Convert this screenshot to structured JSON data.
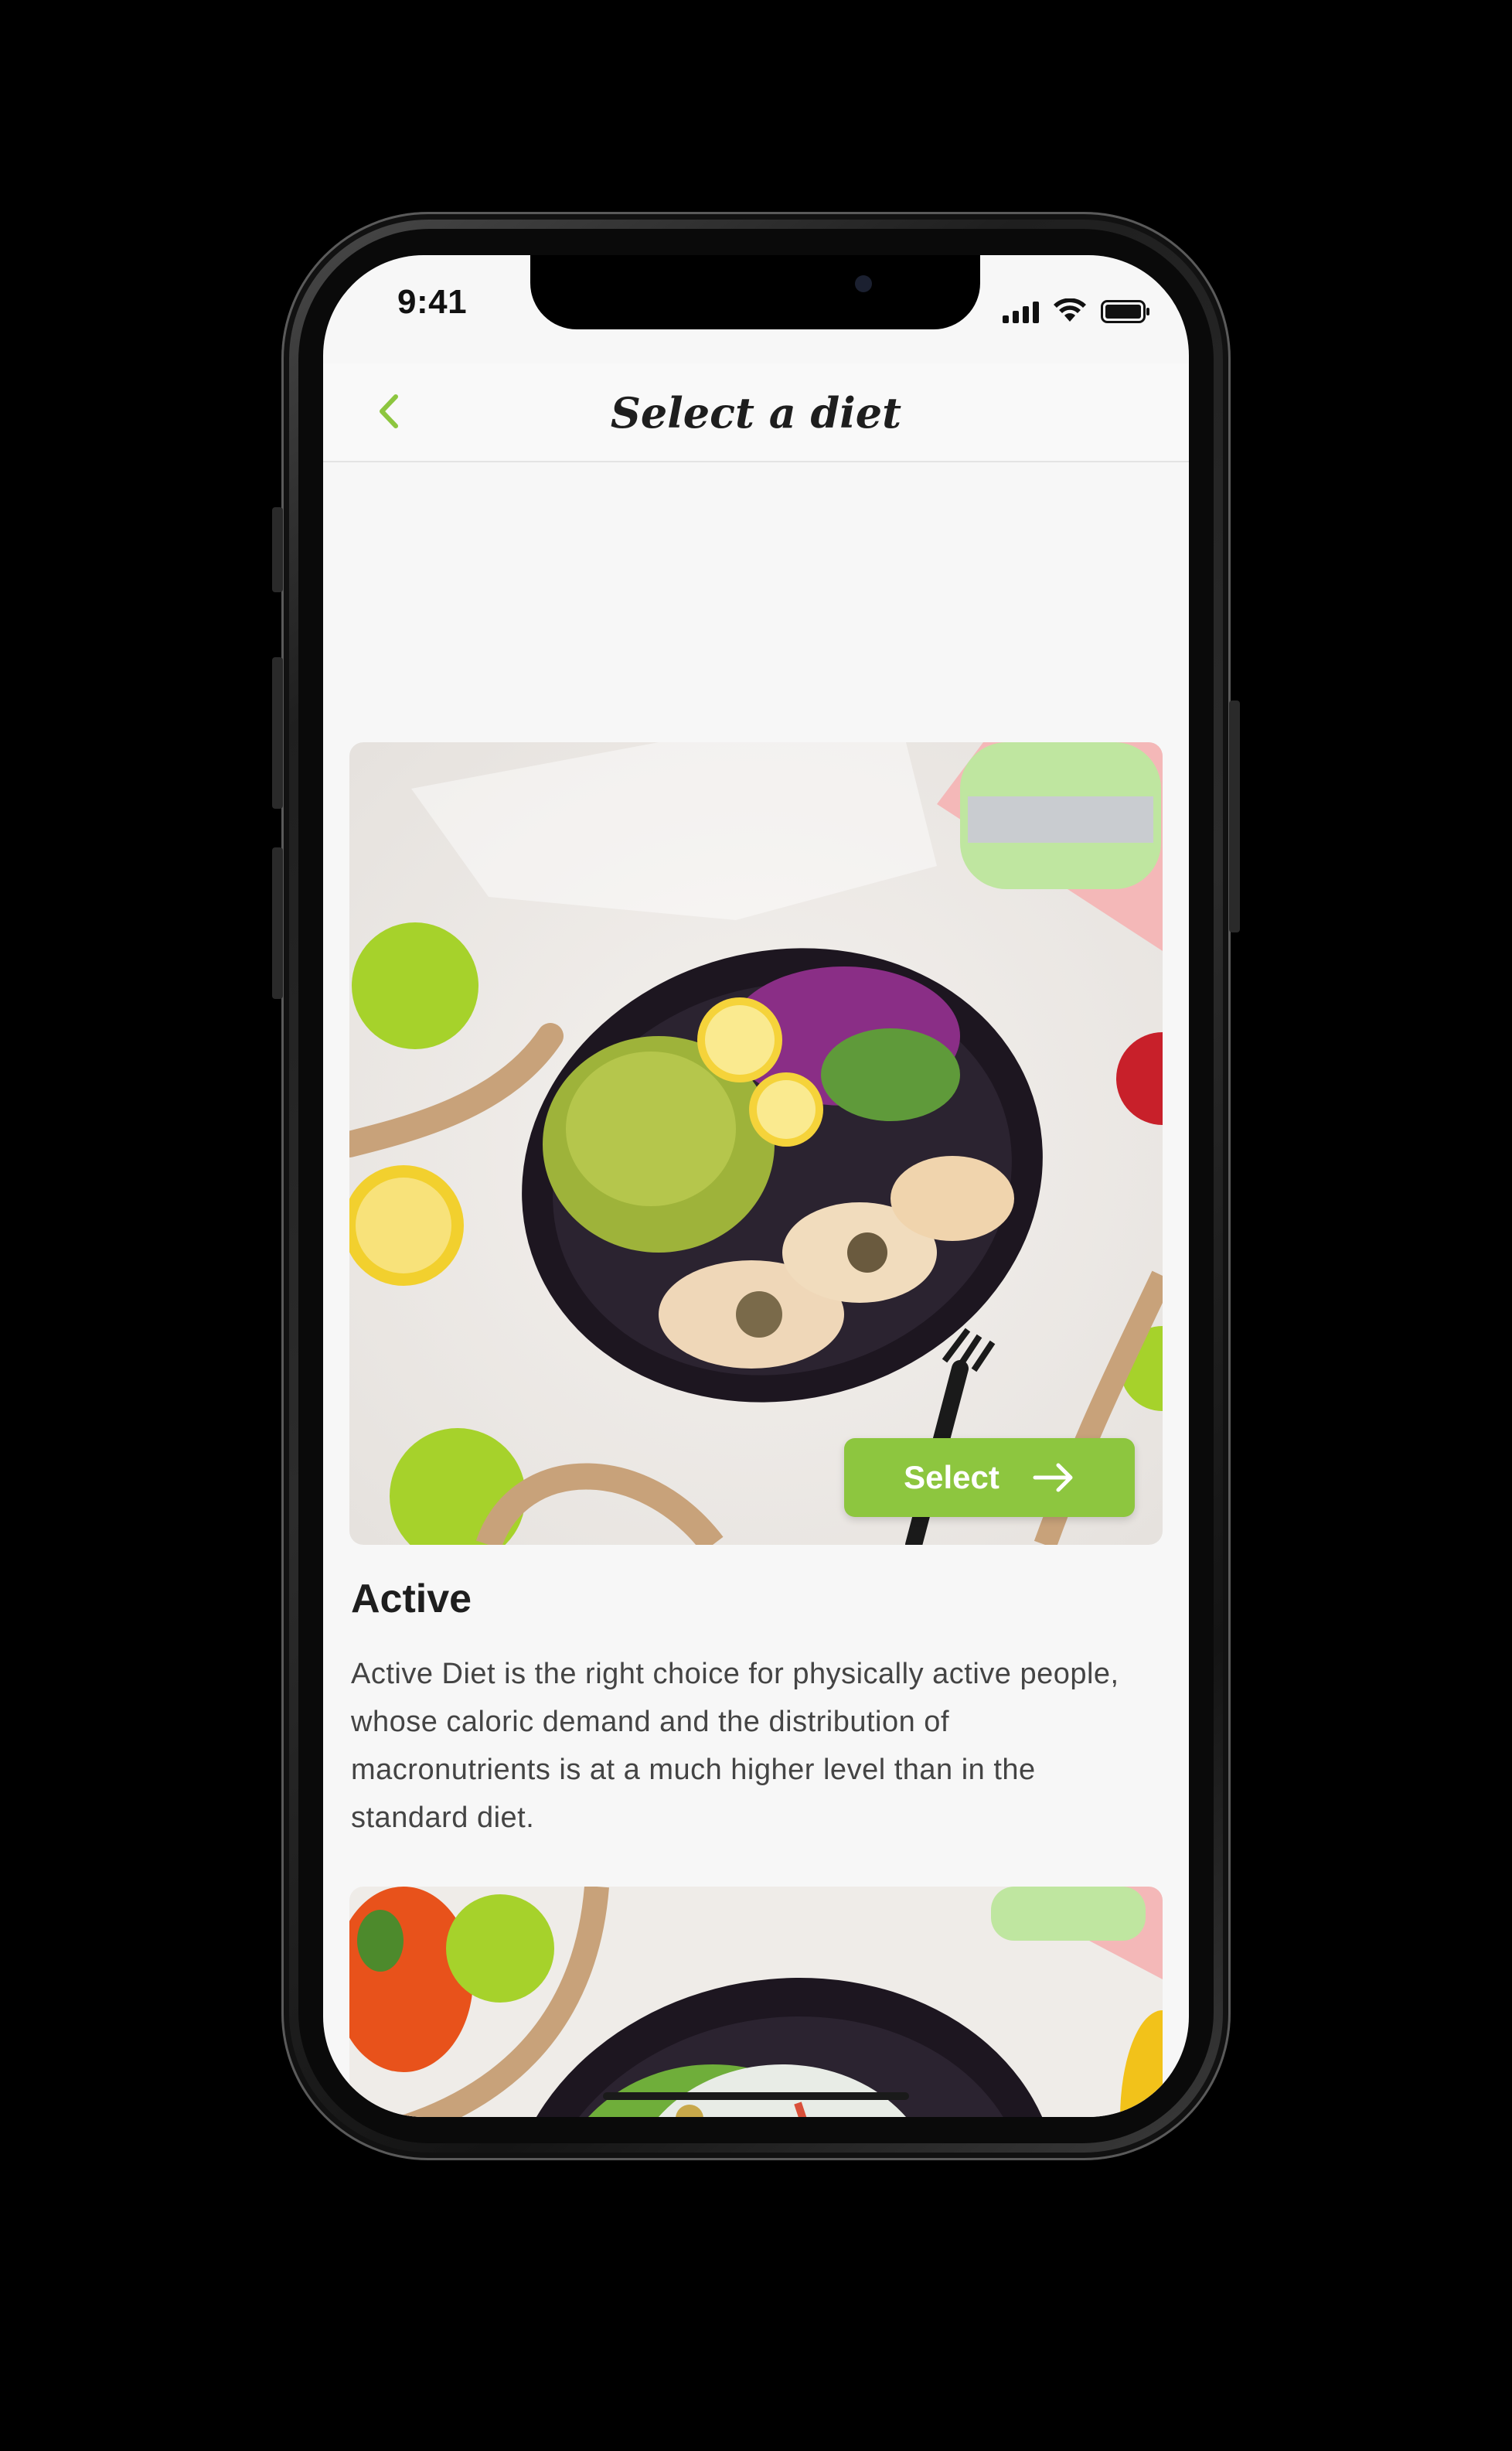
{
  "status_bar": {
    "time": "9:41",
    "icons": [
      "signal-icon",
      "wifi-icon",
      "battery-icon"
    ]
  },
  "header": {
    "back_icon": "chevron-left-icon",
    "title": "Select a diet"
  },
  "diets": [
    {
      "name": "Active",
      "description": "Active Diet is the right choice for physically active people, whose caloric demand and the distribution of macronutrients is at a much higher level than in the standard diet.",
      "select_label": "Select",
      "select_icon": "arrow-right-icon",
      "image": "meal-photo-noodles-chicken"
    },
    {
      "image": "meal-photo-salad"
    }
  ],
  "colors": {
    "accent": "#8dc63f",
    "title": "#1e1e1e",
    "body_text": "#444444",
    "background": "#f7f7f7"
  }
}
